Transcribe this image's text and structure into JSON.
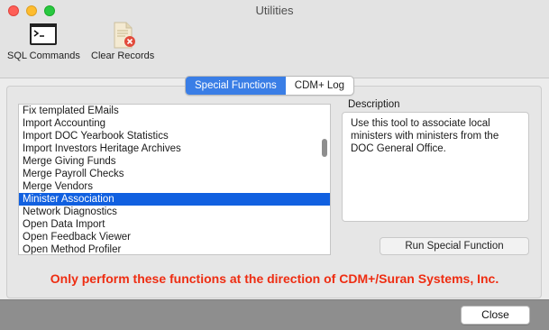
{
  "window": {
    "title": "Utilities"
  },
  "toolbar": {
    "sql_commands_label": "SQL Commands",
    "clear_records_label": "Clear Records"
  },
  "tabs": [
    {
      "label": "Special Functions",
      "active": true
    },
    {
      "label": "CDM+ Log",
      "active": false
    }
  ],
  "functions": {
    "items": [
      "Fix templated EMails",
      "Import Accounting",
      "Import DOC Yearbook Statistics",
      "Import Investors Heritage Archives",
      "Merge Giving Funds",
      "Merge Payroll Checks",
      "Merge Vendors",
      "Minister Association",
      "Network Diagnostics",
      "Open Data Import",
      "Open Feedback Viewer",
      "Open Method Profiler"
    ],
    "selected": "Minister Association"
  },
  "description": {
    "label": "Description",
    "text": "Use this tool to associate local ministers with ministers from the DOC General Office."
  },
  "run_button_label": "Run Special Function",
  "warning_text": "Only perform these functions at the direction of CDM+/Suran Systems, Inc.",
  "close_button_label": "Close",
  "colors": {
    "accent": "#3a7ee6",
    "selection": "#1160e0",
    "warning": "#ee2d12"
  }
}
